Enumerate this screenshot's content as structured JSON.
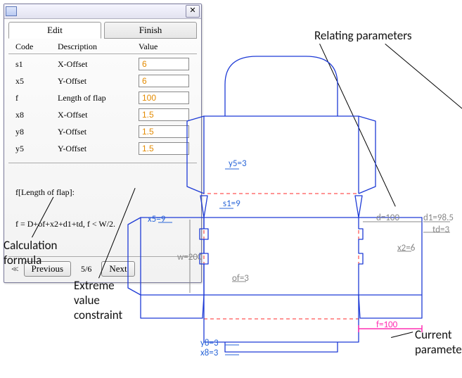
{
  "dialog": {
    "tabs": {
      "edit": "Edit",
      "finish": "Finish"
    },
    "columns": {
      "code": "Code",
      "desc": "Description",
      "value": "Value"
    },
    "rows": [
      {
        "code": "s1",
        "desc": "X-Offset",
        "value": "6"
      },
      {
        "code": "x5",
        "desc": "Y-Offset",
        "value": "6"
      },
      {
        "code": "f",
        "desc": "Length of flap",
        "value": "100"
      },
      {
        "code": "x8",
        "desc": "X-Offset",
        "value": "1.5"
      },
      {
        "code": "y8",
        "desc": "Y-Offset",
        "value": "1.5"
      },
      {
        "code": "y5",
        "desc": "Y-Offset",
        "value": "1.5"
      }
    ],
    "formula_label": "f[Length of flap]:",
    "formula_expr": "f = D+of+x2+d1+td, f < W/2.",
    "pager": {
      "first_icon": "<<",
      "prev": "Previous",
      "count": "5/6",
      "next": "Next"
    },
    "close_glyph": "✕"
  },
  "annotations": {
    "relating": "Relating parameters",
    "calc": "Calculation\nformula",
    "extreme": "Extreme\nvalue\nconstraint",
    "currparam": "Current\nparameter"
  },
  "dims": {
    "y5": "y5=3",
    "s1": "s1=9",
    "x5": "x5=9",
    "d": "d=100",
    "d1": "d1=98.5",
    "td": "td=3",
    "w": "w=200",
    "x2": "x2=6",
    "of": "of=3",
    "f": "f=100",
    "y8": "y8=3",
    "x8": "x8=3"
  }
}
